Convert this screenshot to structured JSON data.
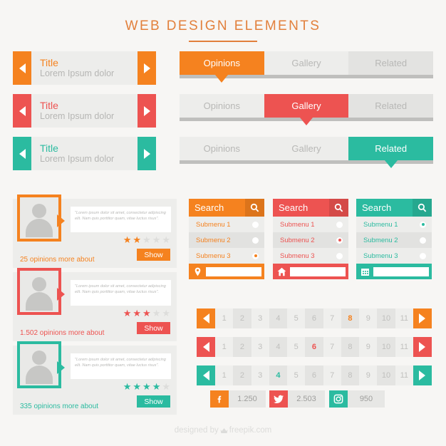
{
  "page": {
    "title": "WEB DESIGN ELEMENTS",
    "background": "#F7F6F4",
    "title_color": "#E2803C"
  },
  "palette": {
    "orange": "#F5821F",
    "red": "#ED5351",
    "teal": "#2BBBA0",
    "gray_light": "#EDEDEB",
    "gray_mid": "#E3E3E1",
    "gray_rail": "#BFBFBD",
    "text_gray": "#B8B8B6"
  },
  "sliders": [
    {
      "name": "slider-orange",
      "title": "Title",
      "subtitle": "Lorem Ipsum dolor",
      "color": "#F5821F",
      "prev_icon": "chevron-left-icon",
      "next_icon": "chevron-right-icon"
    },
    {
      "name": "slider-red",
      "title": "Title",
      "subtitle": "Lorem Ipsum dolor",
      "color": "#ED5351",
      "prev_icon": "chevron-left-icon",
      "next_icon": "chevron-right-icon"
    },
    {
      "name": "slider-teal",
      "title": "Title",
      "subtitle": "Lorem Ipsum dolor",
      "color": "#2BBBA0",
      "prev_icon": "chevron-left-icon",
      "next_icon": "chevron-right-icon"
    }
  ],
  "tabbars": [
    {
      "name": "tabbar-orange",
      "color": "#F5821F",
      "active_index": 0,
      "tabs": [
        "Opinions",
        "Gallery",
        "Related"
      ]
    },
    {
      "name": "tabbar-red",
      "color": "#ED5351",
      "active_index": 1,
      "tabs": [
        "Opinions",
        "Gallery",
        "Related"
      ]
    },
    {
      "name": "tabbar-teal",
      "color": "#2BBBA0",
      "active_index": 2,
      "tabs": [
        "Opinions",
        "Gallery",
        "Related"
      ]
    }
  ],
  "testimonials": [
    {
      "name": "testimonial-orange",
      "color": "#F5821F",
      "quote": "\"Lorem ipsum dolor sit amet, consectetur adipiscing elit. Nam quis porttitor quam, vitae luctus risus\".",
      "rating": 2,
      "max_rating": 5,
      "opinions": "25 opinions more about",
      "button": "Show"
    },
    {
      "name": "testimonial-red",
      "color": "#ED5351",
      "quote": "\"Lorem ipsum dolor sit amet, consectetur adipiscing elit. Nam quis porttitor quam, vitae luctus risus\".",
      "rating": 3,
      "max_rating": 5,
      "opinions": "1.502 opinions more about",
      "button": "Show"
    },
    {
      "name": "testimonial-teal",
      "color": "#2BBBA0",
      "quote": "\"Lorem ipsum dolor sit amet, consectetur adipiscing elit. Nam quis porttitor quam, vitae luctus risus\".",
      "rating": 4,
      "max_rating": 5,
      "opinions": "335 opinions more about",
      "button": "Show"
    }
  ],
  "search_widgets": [
    {
      "name": "search-widget-orange",
      "color": "#F5821F",
      "label": "Search",
      "search_icon": "magnifier-icon",
      "items": [
        "Submenu 1",
        "Submenu 2",
        "Submenu 3"
      ],
      "selected_index": 2,
      "footer_icon": "location-pin-icon",
      "footer_placeholder": ""
    },
    {
      "name": "search-widget-red",
      "color": "#ED5351",
      "label": "Search",
      "search_icon": "magnifier-icon",
      "items": [
        "Submenu 1",
        "Submenu 2",
        "Submenu 3"
      ],
      "selected_index": 1,
      "footer_icon": "home-icon",
      "footer_placeholder": ""
    },
    {
      "name": "search-widget-teal",
      "color": "#2BBBA0",
      "label": "Search",
      "search_icon": "magnifier-icon",
      "items": [
        "Submenu 1",
        "Submenu 2",
        "Submenu 3"
      ],
      "selected_index": 0,
      "footer_icon": "calendar-icon",
      "footer_placeholder": ""
    }
  ],
  "pagers": [
    {
      "name": "pagination-orange",
      "color": "#F5821F",
      "pages": [
        "1",
        "2",
        "3",
        "4",
        "5",
        "6",
        "7",
        "8",
        "9",
        "10",
        "11"
      ],
      "active": "8",
      "prev_icon": "chevron-left-icon",
      "next_icon": "chevron-right-icon"
    },
    {
      "name": "pagination-red",
      "color": "#ED5351",
      "pages": [
        "1",
        "2",
        "3",
        "4",
        "5",
        "6",
        "7",
        "8",
        "9",
        "10",
        "11"
      ],
      "active": "6",
      "prev_icon": "chevron-left-icon",
      "next_icon": "chevron-right-icon"
    },
    {
      "name": "pagination-teal",
      "color": "#2BBBA0",
      "pages": [
        "1",
        "2",
        "3",
        "4",
        "5",
        "6",
        "7",
        "8",
        "9",
        "10",
        "11"
      ],
      "active": "4",
      "prev_icon": "chevron-left-icon",
      "next_icon": "chevron-right-icon"
    }
  ],
  "social": [
    {
      "name": "social-facebook",
      "icon": "facebook-icon",
      "glyph": "f",
      "count": "1.250",
      "color": "#F5821F"
    },
    {
      "name": "social-twitter",
      "icon": "twitter-icon",
      "glyph": "t",
      "count": "2.503",
      "color": "#ED5351"
    },
    {
      "name": "social-instagram",
      "icon": "instagram-icon",
      "glyph": "i",
      "count": "950",
      "color": "#2BBBA0"
    }
  ],
  "credit": {
    "prefix": "designed by",
    "icon": "freepik-crown-icon",
    "brand": "freepik.com"
  }
}
